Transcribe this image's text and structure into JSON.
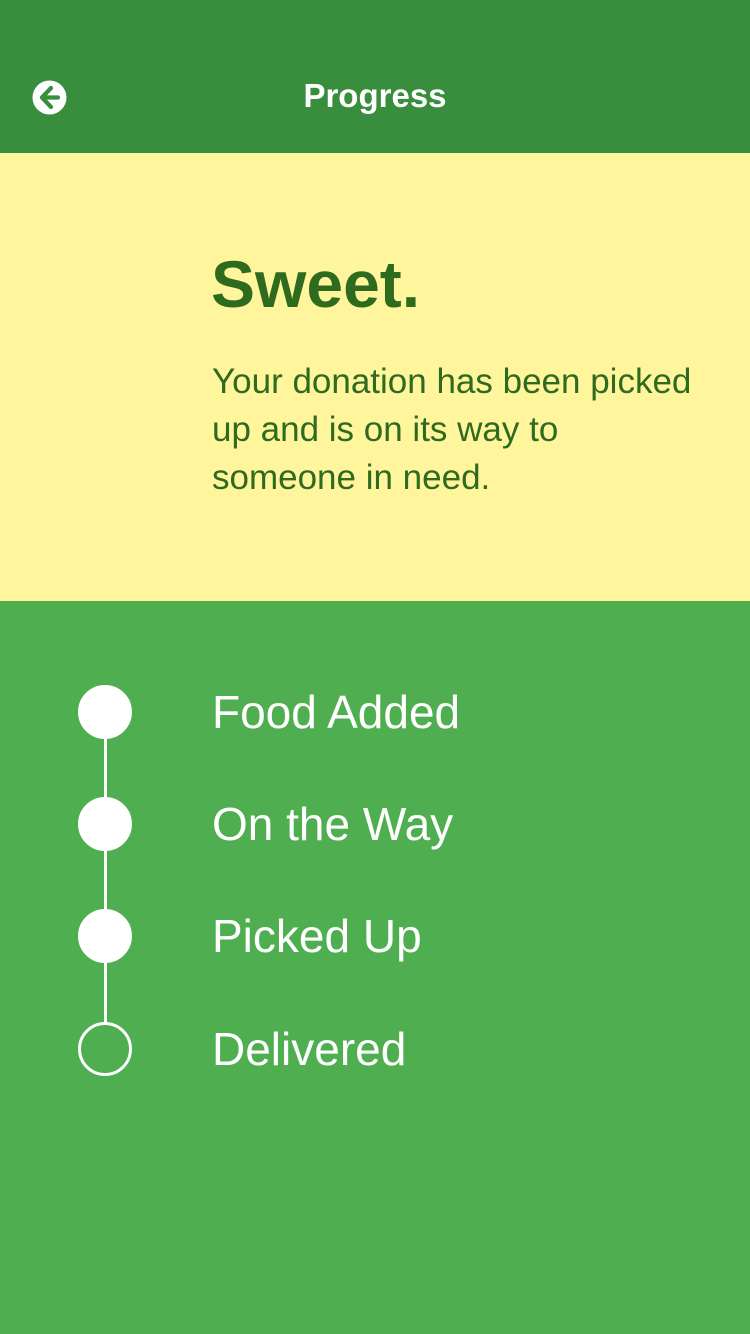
{
  "header": {
    "title": "Progress",
    "back_icon": "arrow-left-circle-icon"
  },
  "banner": {
    "heading": "Sweet.",
    "message": "Your donation has been picked up and is on its way to someone in need."
  },
  "timeline": {
    "steps": [
      {
        "label": "Food Added",
        "status": "complete"
      },
      {
        "label": "On the Way",
        "status": "complete"
      },
      {
        "label": "Picked Up",
        "status": "complete"
      },
      {
        "label": "Delivered",
        "status": "pending"
      }
    ]
  },
  "colors": {
    "header_bg": "#388E3C",
    "banner_bg": "#FFF59D",
    "banner_text": "#2E6B1E",
    "content_bg": "#4FAF50",
    "timeline_fg": "#FFFFFF"
  }
}
